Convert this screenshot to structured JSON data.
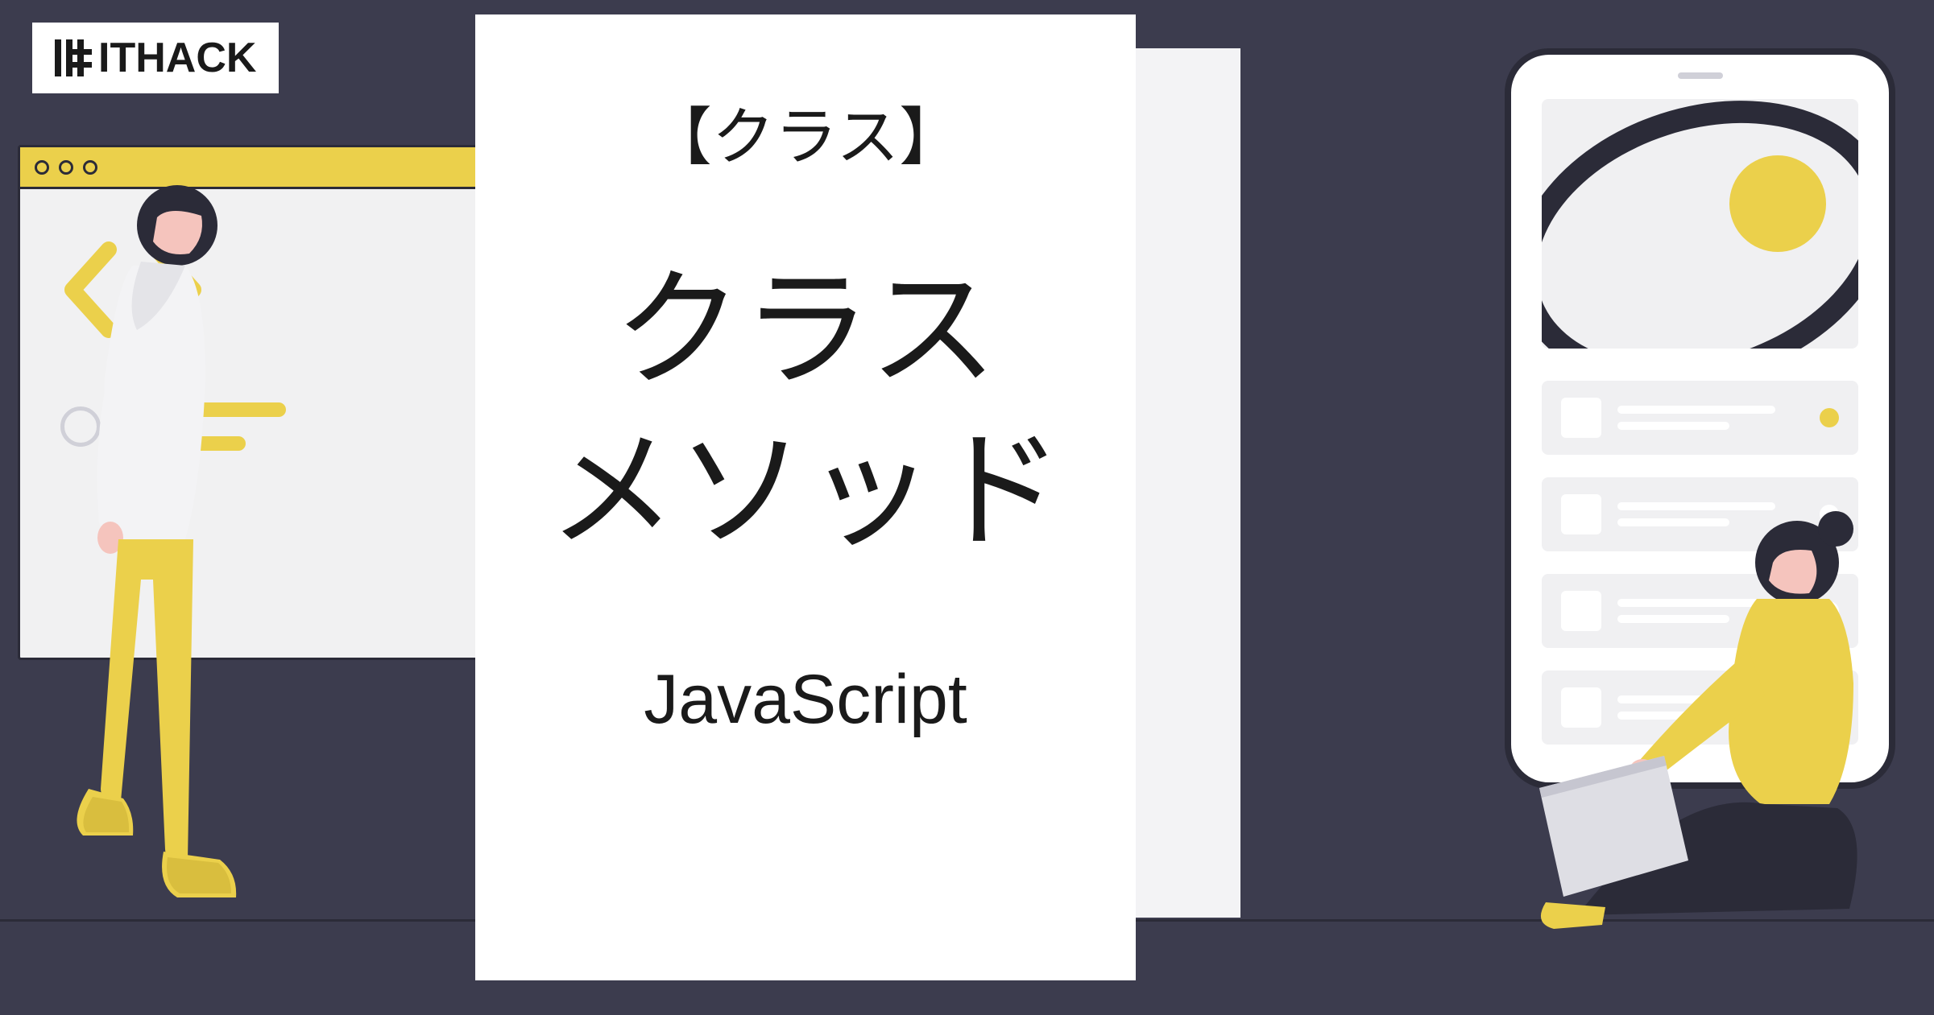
{
  "logo": {
    "brand_text": "ITHACK"
  },
  "center_card": {
    "tag": "【クラス】",
    "title_line1": "クラス",
    "title_line2": "メソッド",
    "language": "JavaScript"
  },
  "colors": {
    "background": "#3c3c4e",
    "accent_yellow": "#ebd04b",
    "dark_outline": "#2b2b38",
    "light_panel": "#f3f3f5",
    "skin": "#f5c4bd"
  }
}
